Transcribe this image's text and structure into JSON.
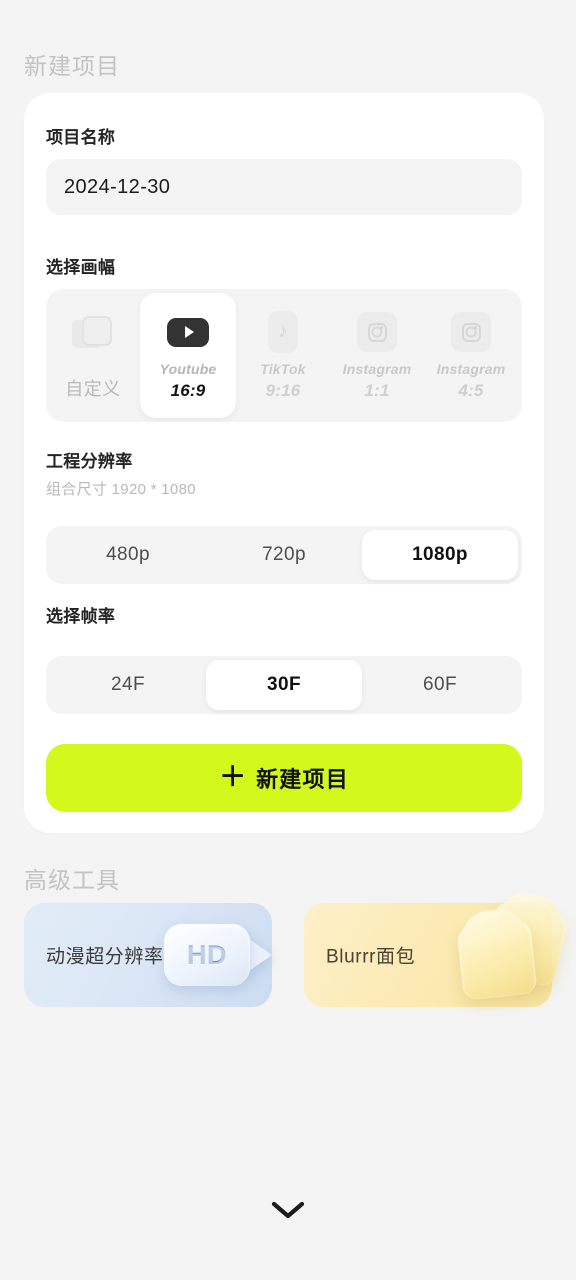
{
  "page": {
    "background_color": "#f4f4f4",
    "accent_color": "#d2f81c"
  },
  "sections": {
    "new_project_title": "新建项目",
    "advanced_tools_title": "高级工具"
  },
  "project_name": {
    "label": "项目名称",
    "value": "2024-12-30",
    "placeholder": "2024-12-30"
  },
  "aspect": {
    "label": "选择画幅",
    "options": [
      {
        "icon": "custom-frames-icon",
        "brand": "",
        "name_cn": "自定义",
        "ratio": "",
        "selected": false
      },
      {
        "icon": "youtube-icon",
        "brand": "Youtube",
        "name_cn": "",
        "ratio": "16:9",
        "selected": true
      },
      {
        "icon": "tiktok-icon",
        "brand": "TikTok",
        "name_cn": "",
        "ratio": "9:16",
        "selected": false
      },
      {
        "icon": "instagram-icon",
        "brand": "Instagram",
        "name_cn": "",
        "ratio": "1:1",
        "selected": false
      },
      {
        "icon": "instagram-icon",
        "brand": "Instagram",
        "name_cn": "",
        "ratio": "4:5",
        "selected": false
      }
    ]
  },
  "resolution": {
    "label": "工程分辨率",
    "sub_label": "组合尺寸 1920 * 1080",
    "options": [
      {
        "label": "480p",
        "selected": false
      },
      {
        "label": "720p",
        "selected": false
      },
      {
        "label": "1080p",
        "selected": true
      }
    ]
  },
  "framerate": {
    "label": "选择帧率",
    "options": [
      {
        "label": "24F",
        "selected": false
      },
      {
        "label": "30F",
        "selected": true
      },
      {
        "label": "60F",
        "selected": false
      }
    ]
  },
  "cta": {
    "plus": "＋",
    "label": "新建项目"
  },
  "tools": [
    {
      "label": "动漫超分辨率",
      "art": "hd-camera-art",
      "color": "#dce7f6"
    },
    {
      "label": "Blurrr面包",
      "art": "bread-art",
      "color": "#fbeab4"
    }
  ],
  "bottom": {
    "chevron": "chevron-down-icon"
  }
}
